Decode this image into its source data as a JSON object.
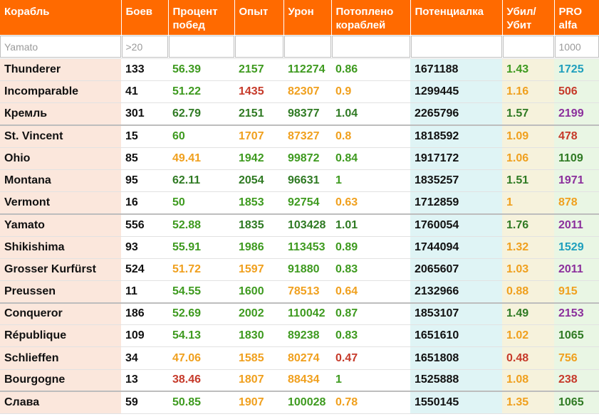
{
  "colors": {
    "header_bg": "#ff6a00",
    "green": "#3e9a1f",
    "dark_green": "#2f7a23",
    "orange": "#f0a01e",
    "red": "#c63a2a",
    "purple": "#8b2f9c",
    "teal": "#1e9fbd"
  },
  "columns": [
    {
      "label": "Корабль",
      "width": 170
    },
    {
      "label": "Боев",
      "width": 66
    },
    {
      "label": "Процент побед",
      "width": 93
    },
    {
      "label": "Опыт",
      "width": 69
    },
    {
      "label": "Урон",
      "width": 67
    },
    {
      "label": "Потоплено кораблей",
      "width": 111
    },
    {
      "label": "Потенциалка",
      "width": 129
    },
    {
      "label": "Убил/ Убит",
      "width": 73
    },
    {
      "label": "PRO alfa",
      "width": 63
    }
  ],
  "filters": [
    {
      "value": "",
      "placeholder": "Yamato"
    },
    {
      "value": "",
      "placeholder": ">20"
    },
    {
      "value": "",
      "placeholder": ""
    },
    {
      "value": "",
      "placeholder": ""
    },
    {
      "value": "",
      "placeholder": ""
    },
    {
      "value": "",
      "placeholder": ""
    },
    {
      "value": "",
      "placeholder": ""
    },
    {
      "value": "",
      "placeholder": ""
    },
    {
      "value": "",
      "placeholder": "1000"
    }
  ],
  "rows": [
    {
      "ship": "Thunderer",
      "battles": "133",
      "winrate": "56.39",
      "exp": "2157",
      "damage": "112274",
      "kills": "0.86",
      "potential": "1671188",
      "kd": "1.43",
      "pro": "1725",
      "tone": [
        "v-black",
        "v-green",
        "v-green",
        "v-green",
        "v-green",
        "v-black",
        "v-green",
        "v-teal"
      ],
      "sep": false
    },
    {
      "ship": "Incomparable",
      "battles": "41",
      "winrate": "51.22",
      "exp": "1435",
      "damage": "82307",
      "kills": "0.9",
      "potential": "1299445",
      "kd": "1.16",
      "pro": "506",
      "tone": [
        "v-black",
        "v-green",
        "v-red",
        "v-orange",
        "v-orange",
        "v-black",
        "v-orange",
        "v-red"
      ],
      "sep": false
    },
    {
      "ship": "Кремль",
      "battles": "301",
      "winrate": "62.79",
      "exp": "2151",
      "damage": "98377",
      "kills": "1.04",
      "potential": "2265796",
      "kd": "1.57",
      "pro": "2199",
      "tone": [
        "v-black",
        "v-dgreen",
        "v-dgreen",
        "v-dgreen",
        "v-dgreen",
        "v-black",
        "v-dgreen",
        "v-purple"
      ],
      "sep": false
    },
    {
      "ship": "St. Vincent",
      "battles": "15",
      "winrate": "60",
      "exp": "1707",
      "damage": "87327",
      "kills": "0.8",
      "potential": "1818592",
      "kd": "1.09",
      "pro": "478",
      "tone": [
        "v-black",
        "v-green",
        "v-orange",
        "v-orange",
        "v-orange",
        "v-black",
        "v-orange",
        "v-red"
      ],
      "sep": true
    },
    {
      "ship": "Ohio",
      "battles": "85",
      "winrate": "49.41",
      "exp": "1942",
      "damage": "99872",
      "kills": "0.84",
      "potential": "1917172",
      "kd": "1.06",
      "pro": "1109",
      "tone": [
        "v-black",
        "v-orange",
        "v-green",
        "v-green",
        "v-green",
        "v-black",
        "v-orange",
        "v-dgreen"
      ],
      "sep": false
    },
    {
      "ship": "Montana",
      "battles": "95",
      "winrate": "62.11",
      "exp": "2054",
      "damage": "96631",
      "kills": "1",
      "potential": "1835257",
      "kd": "1.51",
      "pro": "1971",
      "tone": [
        "v-black",
        "v-dgreen",
        "v-dgreen",
        "v-dgreen",
        "v-green",
        "v-black",
        "v-dgreen",
        "v-purple"
      ],
      "sep": false
    },
    {
      "ship": "Vermont",
      "battles": "16",
      "winrate": "50",
      "exp": "1853",
      "damage": "92754",
      "kills": "0.63",
      "potential": "1712859",
      "kd": "1",
      "pro": "878",
      "tone": [
        "v-black",
        "v-green",
        "v-green",
        "v-green",
        "v-orange",
        "v-black",
        "v-orange",
        "v-orange"
      ],
      "sep": false
    },
    {
      "ship": "Yamato",
      "battles": "556",
      "winrate": "52.88",
      "exp": "1835",
      "damage": "103428",
      "kills": "1.01",
      "potential": "1760054",
      "kd": "1.76",
      "pro": "2011",
      "tone": [
        "v-black",
        "v-green",
        "v-dgreen",
        "v-dgreen",
        "v-dgreen",
        "v-black",
        "v-dgreen",
        "v-purple"
      ],
      "sep": true
    },
    {
      "ship": "Shikishima",
      "battles": "93",
      "winrate": "55.91",
      "exp": "1986",
      "damage": "113453",
      "kills": "0.89",
      "potential": "1744094",
      "kd": "1.32",
      "pro": "1529",
      "tone": [
        "v-black",
        "v-green",
        "v-green",
        "v-green",
        "v-green",
        "v-black",
        "v-orange",
        "v-teal"
      ],
      "sep": false
    },
    {
      "ship": "Grosser Kurfürst",
      "battles": "524",
      "winrate": "51.72",
      "exp": "1597",
      "damage": "91880",
      "kills": "0.83",
      "potential": "2065607",
      "kd": "1.03",
      "pro": "2011",
      "tone": [
        "v-black",
        "v-orange",
        "v-orange",
        "v-green",
        "v-green",
        "v-black",
        "v-orange",
        "v-purple"
      ],
      "sep": false
    },
    {
      "ship": "Preussen",
      "battles": "11",
      "winrate": "54.55",
      "exp": "1600",
      "damage": "78513",
      "kills": "0.64",
      "potential": "2132966",
      "kd": "0.88",
      "pro": "915",
      "tone": [
        "v-black",
        "v-green",
        "v-green",
        "v-orange",
        "v-orange",
        "v-black",
        "v-orange",
        "v-orange"
      ],
      "sep": false
    },
    {
      "ship": "Conqueror",
      "battles": "186",
      "winrate": "52.69",
      "exp": "2002",
      "damage": "110042",
      "kills": "0.87",
      "potential": "1853107",
      "kd": "1.49",
      "pro": "2153",
      "tone": [
        "v-black",
        "v-green",
        "v-green",
        "v-green",
        "v-green",
        "v-black",
        "v-dgreen",
        "v-purple"
      ],
      "sep": true
    },
    {
      "ship": "République",
      "battles": "109",
      "winrate": "54.13",
      "exp": "1830",
      "damage": "89238",
      "kills": "0.83",
      "potential": "1651610",
      "kd": "1.02",
      "pro": "1065",
      "tone": [
        "v-black",
        "v-green",
        "v-green",
        "v-green",
        "v-green",
        "v-black",
        "v-orange",
        "v-dgreen"
      ],
      "sep": false
    },
    {
      "ship": "Schlieffen",
      "battles": "34",
      "winrate": "47.06",
      "exp": "1585",
      "damage": "80274",
      "kills": "0.47",
      "potential": "1651808",
      "kd": "0.48",
      "pro": "756",
      "tone": [
        "v-black",
        "v-orange",
        "v-orange",
        "v-orange",
        "v-red",
        "v-black",
        "v-red",
        "v-orange"
      ],
      "sep": false
    },
    {
      "ship": "Bourgogne",
      "battles": "13",
      "winrate": "38.46",
      "exp": "1807",
      "damage": "88434",
      "kills": "1",
      "potential": "1525888",
      "kd": "1.08",
      "pro": "238",
      "tone": [
        "v-black",
        "v-red",
        "v-orange",
        "v-orange",
        "v-green",
        "v-black",
        "v-orange",
        "v-red"
      ],
      "sep": false
    },
    {
      "ship": "Слава",
      "battles": "59",
      "winrate": "50.85",
      "exp": "1907",
      "damage": "100028",
      "kills": "0.78",
      "potential": "1550145",
      "kd": "1.35",
      "pro": "1065",
      "tone": [
        "v-black",
        "v-green",
        "v-orange",
        "v-green",
        "v-orange",
        "v-black",
        "v-orange",
        "v-dgreen"
      ],
      "sep": true
    }
  ]
}
